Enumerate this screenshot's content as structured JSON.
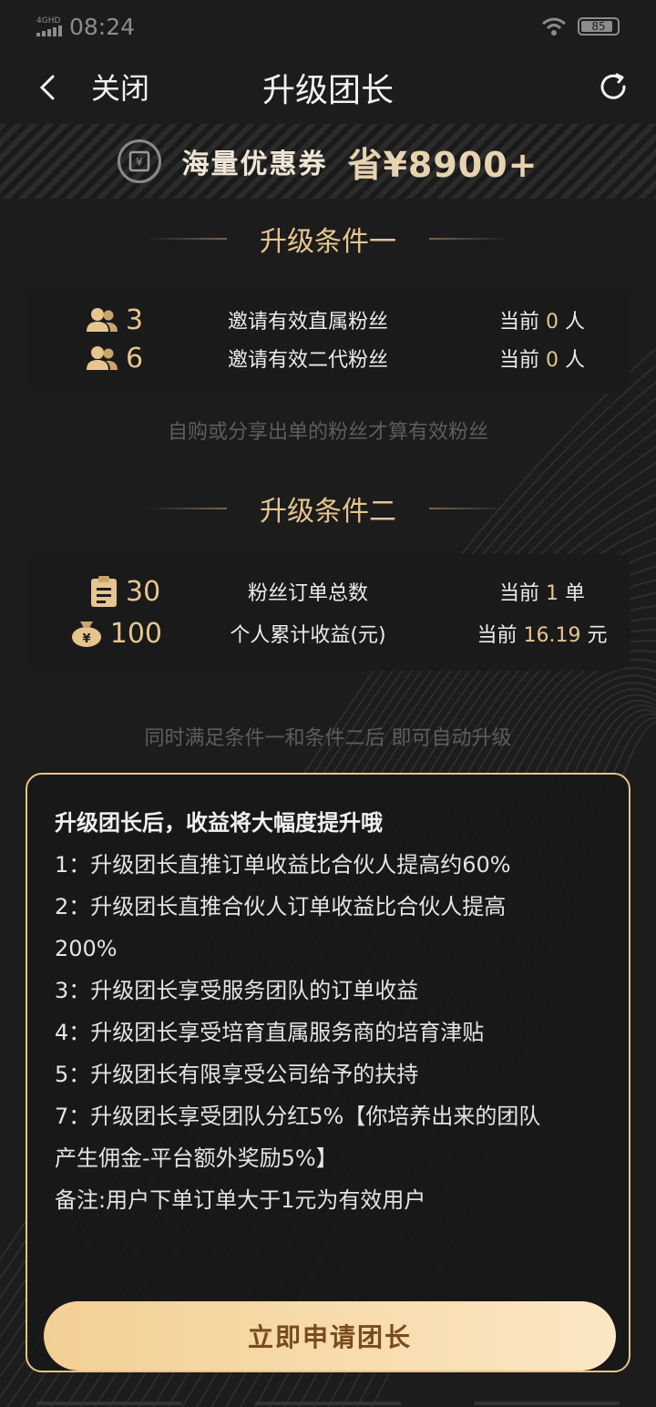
{
  "status": {
    "network": "4GHD",
    "time": "08:24",
    "battery": "85"
  },
  "nav": {
    "close_label": "关闭",
    "title": "升级团长"
  },
  "banner": {
    "text": "海量优惠券",
    "save": "省¥8900+"
  },
  "condition1": {
    "title": "升级条件一",
    "rows": [
      {
        "icon": "users-icon",
        "num": "3",
        "label": "邀请有效直属粉丝",
        "pre": "当前",
        "value": "0",
        "unit": "人"
      },
      {
        "icon": "users-icon",
        "num": "6",
        "label": "邀请有效二代粉丝",
        "pre": "当前",
        "value": "0",
        "unit": "人"
      }
    ],
    "hint": "自购或分享出单的粉丝才算有效粉丝"
  },
  "condition2": {
    "title": "升级条件二",
    "rows": [
      {
        "icon": "clipboard-icon",
        "num": "30",
        "label": "粉丝订单总数",
        "pre": "当前",
        "value": "1",
        "unit": "单"
      },
      {
        "icon": "money-bag-icon",
        "num": "100",
        "label": "个人累计收益(元)",
        "pre": "当前",
        "value": "16.19",
        "unit": "元"
      }
    ],
    "hint": "同时满足条件一和条件二后 即可自动升级"
  },
  "benefits": {
    "heading": "升级团长后，收益将大幅度提升哦",
    "lines": [
      "1：升级团长直推订单收益比合伙人提高约60%",
      "2：升级团长直推合伙人订单收益比合伙人提高",
      "200%",
      "3：升级团长享受服务团队的订单收益",
      "4：升级团长享受培育直属服务商的培育津贴",
      "5：升级团长有限享受公司给予的扶持",
      "7：升级团长享受团队分红5%【你培养出来的团队",
      "产生佣金-平台额外奖励5%】",
      "备注:用户下单订单大于1元为有效用户"
    ],
    "button": "立即申请团长"
  },
  "colors": {
    "accent": "#e6c58e",
    "background": "#1c1c1d",
    "button_start": "#f3cf94",
    "button_end": "#fbe7c4"
  }
}
